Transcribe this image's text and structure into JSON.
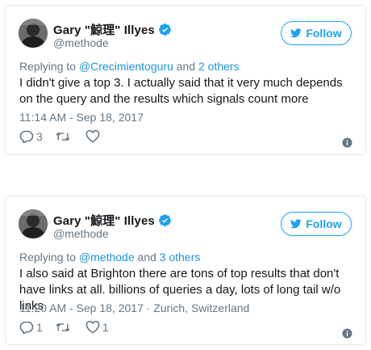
{
  "tweets": [
    {
      "author": {
        "display_name": "Gary \"鯨理\" Illyes",
        "handle": "@methode"
      },
      "follow_label": "Follow",
      "replying": {
        "prefix": "Replying to ",
        "target": "@Crecimientoguru",
        "joiner": " and ",
        "others": "2 others"
      },
      "text": "I didn't give a top 3. I actually said that it very much depends on the query and the results which signals count more",
      "timestamp": "11:14 AM - Sep 18, 2017",
      "reply_count": "3",
      "retweet_count": "",
      "like_count": ""
    },
    {
      "author": {
        "display_name": "Gary \"鯨理\" Illyes",
        "handle": "@methode"
      },
      "follow_label": "Follow",
      "replying": {
        "prefix": "Replying to ",
        "target": "@methode",
        "joiner": " and ",
        "others": "3 others"
      },
      "text": "I also said at Brighton there are tons of top results that don't have links at all. billions of queries a day, lots of long tail w/o links",
      "timestamp": "11:20 AM - Sep 18, 2017 · Zurich, Switzerland",
      "reply_count": "1",
      "retweet_count": "",
      "like_count": "1"
    }
  ],
  "icons": {
    "verified": "verified-badge-icon",
    "twitter": "twitter-bird-icon",
    "reply": "reply-icon",
    "retweet": "retweet-icon",
    "like": "heart-icon",
    "info": "info-icon"
  },
  "colors": {
    "accent": "#1da1f2",
    "link": "#1b95e0",
    "muted": "#657786",
    "border": "#e1e8ed"
  }
}
